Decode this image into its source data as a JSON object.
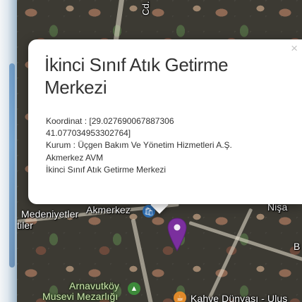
{
  "map": {
    "labels": {
      "street_top": "Cd.",
      "medeniyetler": "Medeniyetler",
      "tiler": "tiler",
      "akmerkez": "Akmerkez",
      "right_top": "Nişa",
      "right_b": "B",
      "arnavutkoy": "Arnavutköy",
      "mezarligi": "Musevi Mezarlığı",
      "kahve": "Kahve Dünyası - Ulus"
    },
    "marker": {
      "color": "#7b2f9e"
    }
  },
  "popup": {
    "close_symbol": "×",
    "title": "İkinci Sınıf Atık Getirme Merkezi",
    "lines": [
      "Koordinat : [29.027690067887306",
      "41.077034953302764]",
      "Kurum : Üçgen Bakım Ve Yönetim Hizmetleri A.Ş.",
      "Akmerkez AVM",
      "İkinci Sınıf Atık Getirme Merkezi"
    ]
  }
}
